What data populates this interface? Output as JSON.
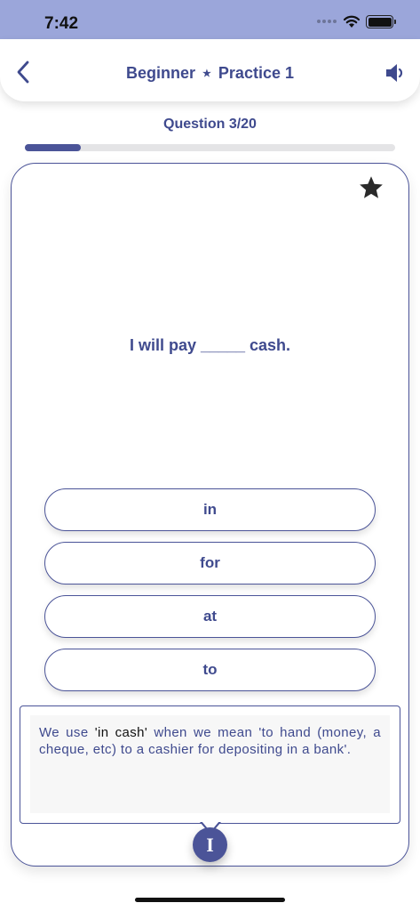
{
  "status_bar": {
    "time": "7:42",
    "icons": [
      "signal-icon",
      "wifi-icon",
      "battery-icon"
    ]
  },
  "nav": {
    "title_left": "Beginner",
    "title_separator": "★",
    "title_right": "Practice 1",
    "back_icon": "chevron-left-icon",
    "sound_icon": "speaker-icon"
  },
  "progress": {
    "label": "Question 3/20",
    "value": 0.15
  },
  "question": {
    "sentence": "I will pay _____ cash.",
    "bookmark_icon": "star-icon"
  },
  "options": [
    {
      "label": "in"
    },
    {
      "label": "for"
    },
    {
      "label": "at"
    },
    {
      "label": "to"
    }
  ],
  "explanation": {
    "before": "We use ",
    "highlight": "'in cash'",
    "after": " when we mean 'to hand (money, a cheque, etc) to a cashier for depositing in a bank'."
  },
  "info_button": {
    "label": "I"
  },
  "colors": {
    "accent": "#4b5498",
    "status_bar": "#9ba6da",
    "text": "#3f4a8e"
  }
}
